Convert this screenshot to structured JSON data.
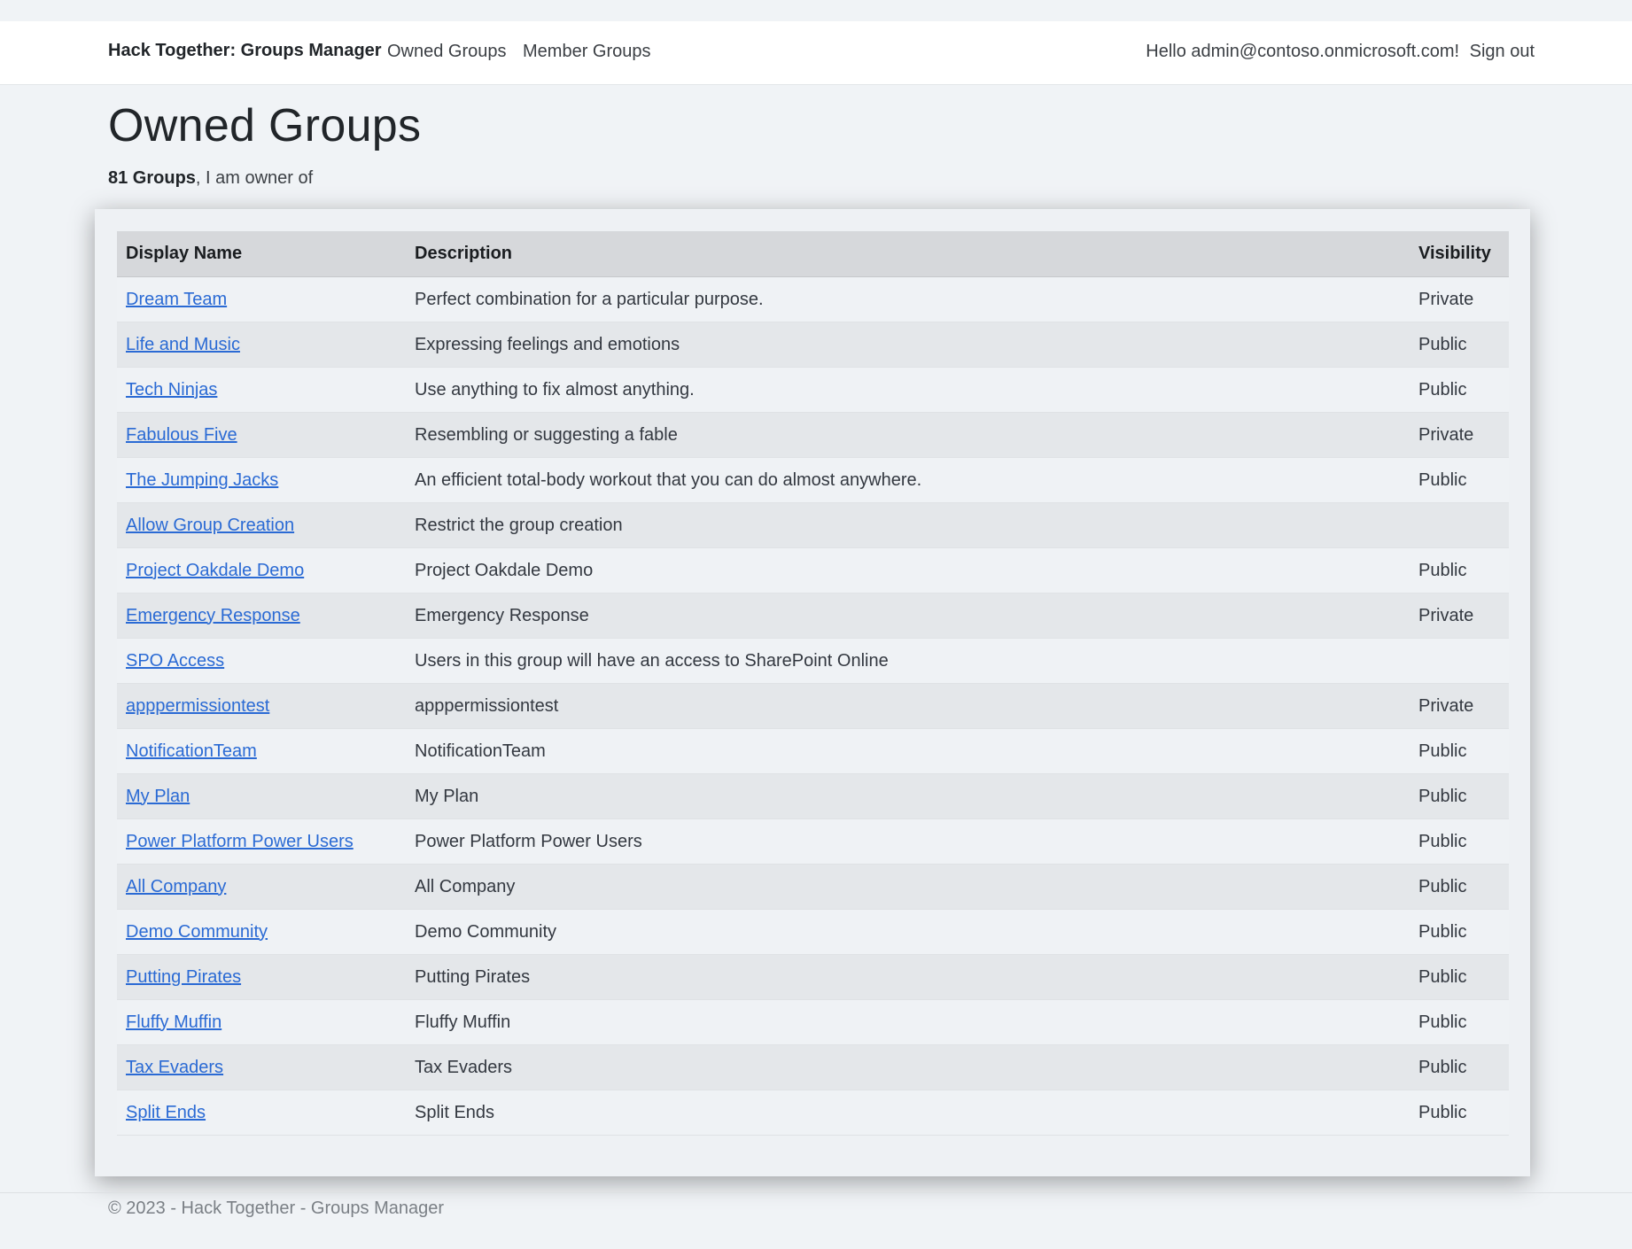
{
  "navbar": {
    "brand": "Hack Together: Groups Manager",
    "links": [
      "Owned Groups",
      "Member Groups"
    ],
    "greeting": "Hello admin@contoso.onmicrosoft.com!",
    "signout": "Sign out"
  },
  "page": {
    "title": "Owned Groups",
    "count_bold": "81 Groups",
    "count_suffix": ", I am owner of"
  },
  "table": {
    "headers": [
      "Display Name",
      "Description",
      "Visibility"
    ],
    "rows": [
      {
        "name": "Dream Team",
        "description": "Perfect combination for a particular purpose.",
        "visibility": "Private"
      },
      {
        "name": "Life and Music",
        "description": "Expressing feelings and emotions",
        "visibility": "Public"
      },
      {
        "name": "Tech Ninjas",
        "description": "Use anything to fix almost anything.",
        "visibility": "Public"
      },
      {
        "name": "Fabulous Five",
        "description": "Resembling or suggesting a fable",
        "visibility": "Private"
      },
      {
        "name": "The Jumping Jacks",
        "description": "An efficient total-body workout that you can do almost anywhere.",
        "visibility": "Public"
      },
      {
        "name": "Allow Group Creation",
        "description": "Restrict the group creation",
        "visibility": ""
      },
      {
        "name": "Project Oakdale Demo",
        "description": "Project Oakdale Demo",
        "visibility": "Public"
      },
      {
        "name": "Emergency Response",
        "description": "Emergency Response",
        "visibility": "Private"
      },
      {
        "name": "SPO Access",
        "description": "Users in this group will have an access to SharePoint Online",
        "visibility": ""
      },
      {
        "name": "apppermissiontest",
        "description": "apppermissiontest",
        "visibility": "Private"
      },
      {
        "name": "NotificationTeam",
        "description": "NotificationTeam",
        "visibility": "Public"
      },
      {
        "name": "My Plan",
        "description": "My Plan",
        "visibility": "Public"
      },
      {
        "name": "Power Platform Power Users",
        "description": "Power Platform Power Users",
        "visibility": "Public"
      },
      {
        "name": "All Company",
        "description": "All Company",
        "visibility": "Public"
      },
      {
        "name": "Demo Community",
        "description": "Demo Community",
        "visibility": "Public"
      },
      {
        "name": "Putting Pirates",
        "description": "Putting Pirates",
        "visibility": "Public"
      },
      {
        "name": "Fluffy Muffin",
        "description": "Fluffy Muffin",
        "visibility": "Public"
      },
      {
        "name": "Tax Evaders",
        "description": "Tax Evaders",
        "visibility": "Public"
      },
      {
        "name": "Split Ends",
        "description": "Split Ends",
        "visibility": "Public"
      }
    ]
  },
  "footer": {
    "text": "© 2023 - Hack Together - Groups Manager"
  },
  "colors": {
    "link": "#2a6ad4",
    "header_bg": "#d6d8db",
    "page_bg": "#f0f3f6"
  }
}
